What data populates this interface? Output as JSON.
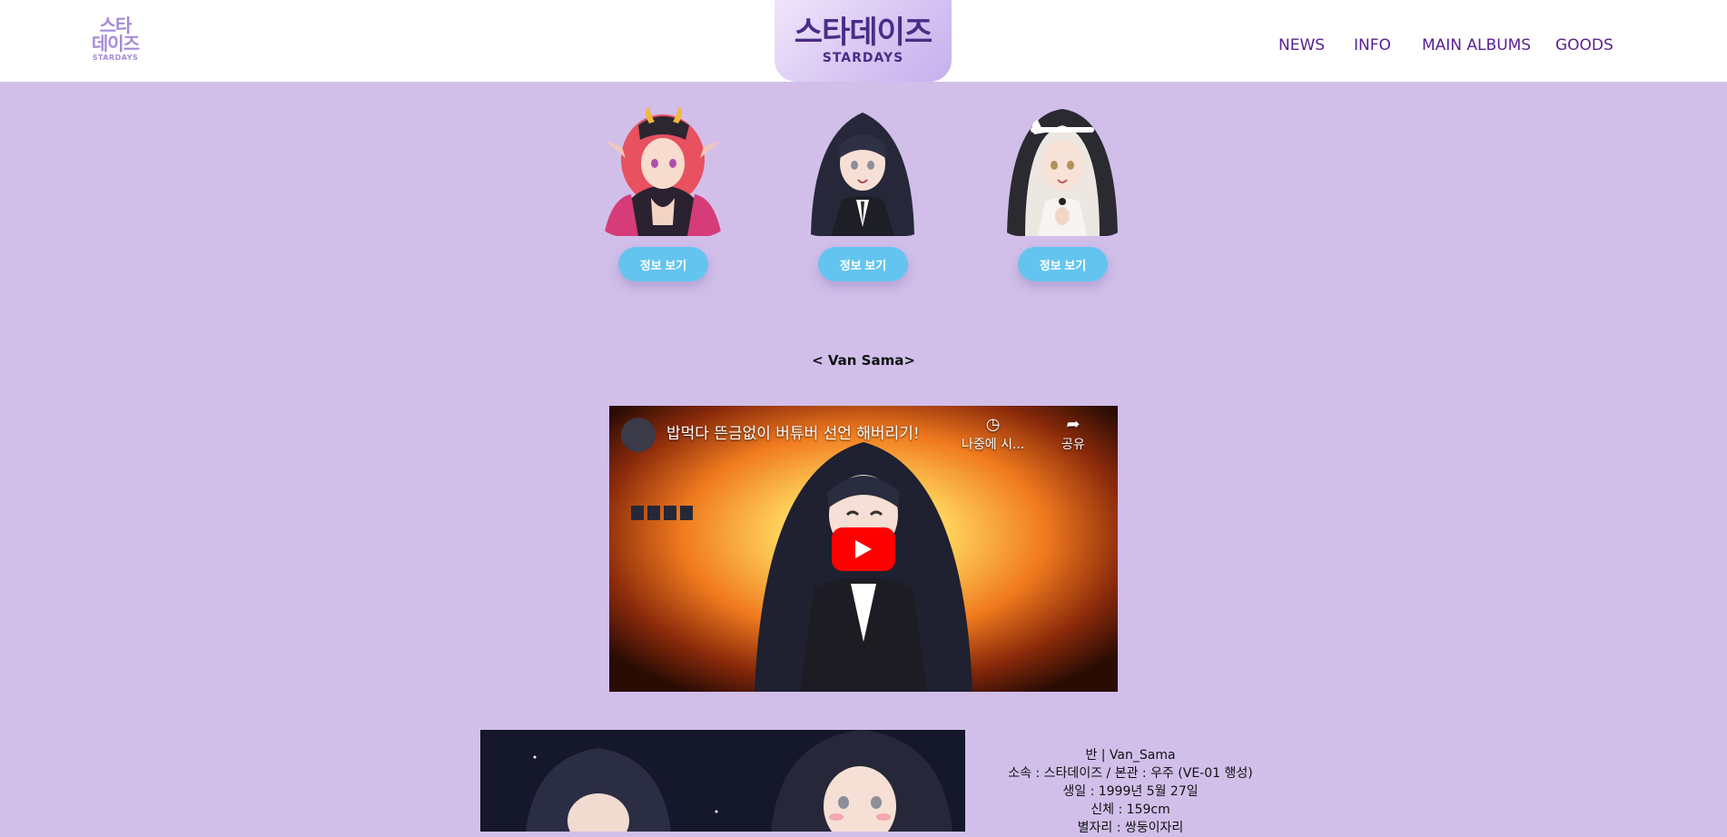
{
  "header": {
    "small_logo": {
      "line1": "스타\n데이즈",
      "line2": "STARDAYS"
    },
    "center_logo": {
      "kr": "스타데이즈",
      "en": "STARDAYS"
    },
    "nav": [
      "NEWS",
      "INFO",
      "MAIN ALBUMS",
      "GOODS"
    ]
  },
  "members": [
    {
      "button_label": "정보 보기"
    },
    {
      "button_label": "정보 보기"
    },
    {
      "button_label": "정보 보기"
    }
  ],
  "section_title": "< Van Sama>",
  "video": {
    "title": "밥먹다 뜬금없이 버튜버 선언 해버리기!",
    "watch_later": "나중에 시...",
    "share": "공유"
  },
  "profile": {
    "lines": [
      "반 | Van_Sama",
      "소속 : 스타데이즈 / 본관 : 우주 (VE-01 행성)",
      "생일 : 1999년 5월 27일",
      "신체 : 159cm",
      "별자리 : 쌍둥이자리"
    ]
  },
  "colors": {
    "background": "#d1bfea",
    "nav_text": "#5a2190",
    "button": "#63c4f0",
    "youtube_red": "#ff0000"
  }
}
